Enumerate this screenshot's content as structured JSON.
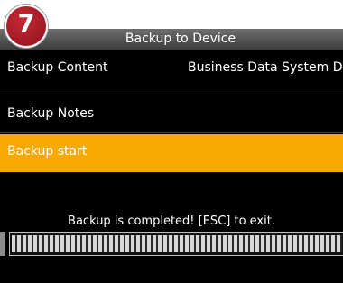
{
  "step_number": "7",
  "window": {
    "title": "Backup to Device"
  },
  "menu": [
    {
      "label": "Backup Content",
      "value": "Business Data System Da"
    },
    {
      "label": "Backup Notes",
      "value": ""
    },
    {
      "label": "Backup start",
      "value": ""
    }
  ],
  "status_message": "Backup is completed! [ESC] to exit.",
  "progress": {
    "percent": 100
  },
  "colors": {
    "highlight": "#f7a900",
    "badge": "#a81c28",
    "background": "#000000"
  }
}
